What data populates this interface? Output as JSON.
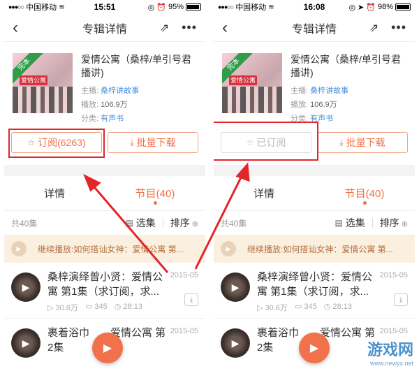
{
  "screens": [
    {
      "status": {
        "signal": "●●●○○",
        "carrier": "中国移动",
        "time": "15:51",
        "battery": "95%",
        "battery_level": 0.95
      },
      "nav": {
        "title": "专辑详情",
        "back_icon": "back-icon",
        "share_icon": "share-icon",
        "more_icon": "more-icon"
      },
      "album": {
        "cover_badge": "完本",
        "cover_logo": "爱情公寓",
        "title": "爱情公寓（桑梓/单引号君播讲)",
        "host_label": "主播:",
        "host": "桑梓讲故事",
        "plays_label": "播放:",
        "plays": "106.9万",
        "category_label": "分类:",
        "category": "有声书"
      },
      "buttons": {
        "subscribe": "订阅(6263)",
        "download": "批量下载"
      },
      "tabs": {
        "detail": "详情",
        "episodes": "节目(40)"
      },
      "listhead": {
        "count": "共40集",
        "select": "选集",
        "sort": "排序"
      },
      "continue": "继续播放:如何搭讪女神：爱情公寓 第...",
      "tracks": [
        {
          "title": "桑梓演绎曾小贤：爱情公寓 第1集（求订阅，求...",
          "date": "2015-05",
          "plays": "30.6万",
          "comments": "345",
          "duration": "28:13"
        },
        {
          "title": "裹着浴巾　　爱情公寓 第2集",
          "date": "2015-05"
        }
      ]
    },
    {
      "status": {
        "signal": "●●●○○",
        "carrier": "中国移动",
        "time": "16:08",
        "battery": "98%",
        "battery_level": 0.98
      },
      "nav": {
        "title": "专辑详情",
        "back_icon": "back-icon",
        "share_icon": "share-icon",
        "more_icon": "more-icon"
      },
      "album": {
        "cover_badge": "完本",
        "cover_logo": "爱情公寓",
        "title": "爱情公寓（桑梓/单引号君播讲)",
        "host_label": "主播:",
        "host": "桑梓讲故事",
        "plays_label": "播放:",
        "plays": "106.9万",
        "category_label": "分类:",
        "category": "有声书"
      },
      "buttons": {
        "subscribe": "已订阅",
        "download": "批量下载"
      },
      "tabs": {
        "detail": "详情",
        "episodes": "节目(40)"
      },
      "listhead": {
        "count": "共40集",
        "select": "选集",
        "sort": "排序"
      },
      "continue": "继续播放:如何搭讪女神：爱情公寓 第...",
      "tracks": [
        {
          "title": "桑梓演绎曾小贤：爱情公寓 第1集（求订阅，求...",
          "date": "2015-05",
          "plays": "30.6万",
          "comments": "345",
          "duration": "28:13"
        },
        {
          "title": "裹着浴巾　　爱情公寓 第2集",
          "date": "2015-05"
        }
      ]
    }
  ],
  "watermark": {
    "text": "游戏网",
    "url": "www.newyx.net"
  },
  "colors": {
    "accent": "#f0714a",
    "highlight": "#e3252a",
    "link": "#4c90d9"
  }
}
